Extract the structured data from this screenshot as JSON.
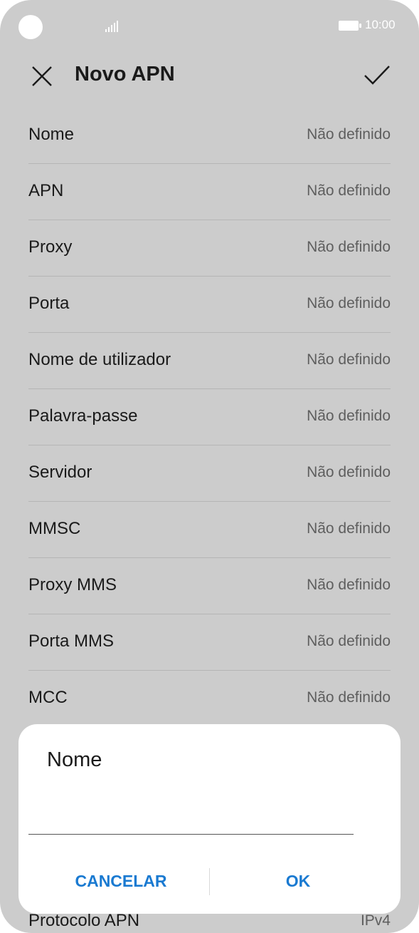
{
  "status_bar": {
    "time": "10:00"
  },
  "header": {
    "title": "Novo APN"
  },
  "fields": [
    {
      "label": "Nome",
      "value": "Não definido"
    },
    {
      "label": "APN",
      "value": "Não definido"
    },
    {
      "label": "Proxy",
      "value": "Não definido"
    },
    {
      "label": "Porta",
      "value": "Não definido"
    },
    {
      "label": "Nome de utilizador",
      "value": "Não definido"
    },
    {
      "label": "Palavra-passe",
      "value": "Não definido"
    },
    {
      "label": "Servidor",
      "value": "Não definido"
    },
    {
      "label": "MMSC",
      "value": "Não definido"
    },
    {
      "label": "Proxy MMS",
      "value": "Não definido"
    },
    {
      "label": "Porta MMS",
      "value": "Não definido"
    },
    {
      "label": "MCC",
      "value": "Não definido"
    }
  ],
  "bottom_field": {
    "label": "Protocolo APN",
    "value": "IPv4"
  },
  "dialog": {
    "title": "Nome",
    "input_value": "",
    "cancel_label": "CANCELAR",
    "ok_label": "OK"
  },
  "colors": {
    "background": "#cccccc",
    "dialog_background": "#ffffff",
    "accent": "#1a7ad1",
    "text": "#1a1a1a",
    "secondary_text": "#5e5e5e"
  }
}
